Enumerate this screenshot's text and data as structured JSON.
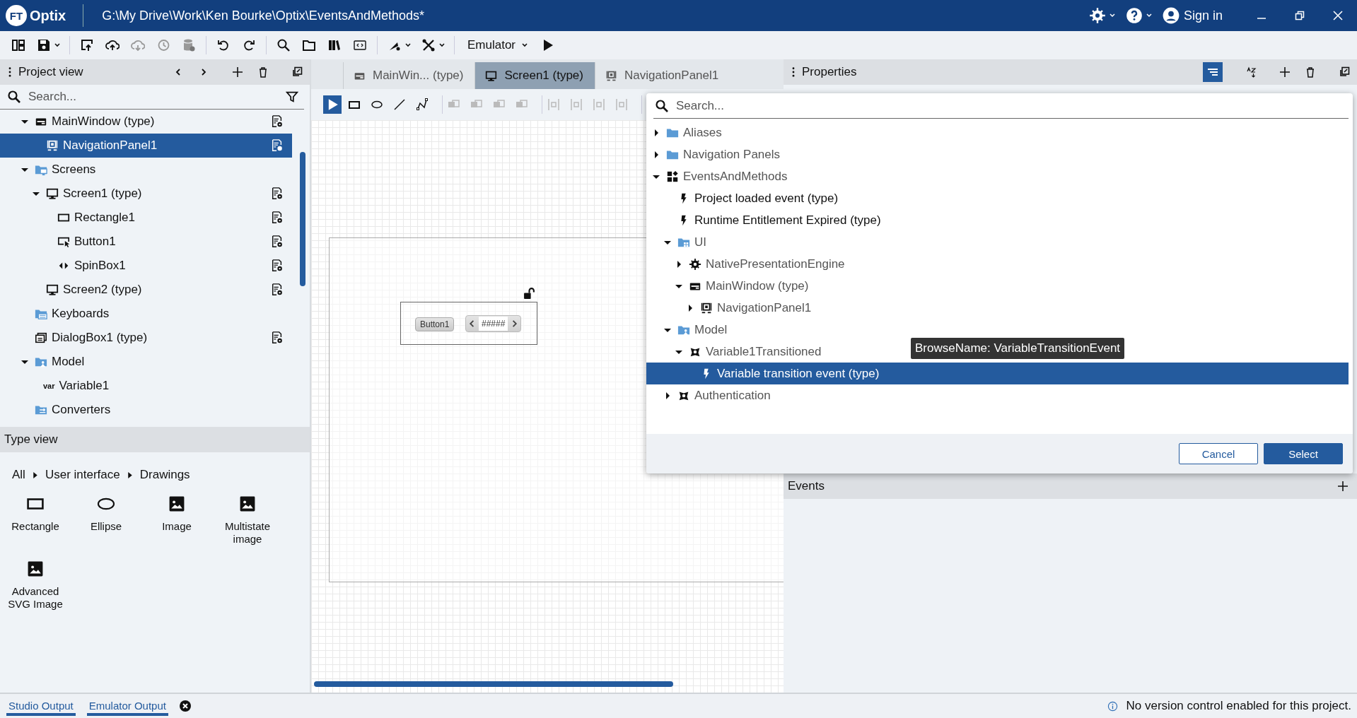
{
  "app": {
    "logo_badge": "FT",
    "logo": "Optix",
    "path": "G:\\My Drive\\Work\\Ken Bourke\\Optix\\EventsAndMethods*",
    "sign_in": "Sign in"
  },
  "toolbar": {
    "emulator": "Emulator"
  },
  "project_view": {
    "title": "Project view",
    "search": {
      "placeholder": "Search..."
    },
    "tree": [
      {
        "label": "MainWindow (type)",
        "kind": "window",
        "expanded": true,
        "selected": false,
        "settings_button": true,
        "children": [
          {
            "label": "NavigationPanel1",
            "kind": "panel",
            "selected": true,
            "settings_button": true
          }
        ]
      },
      {
        "label": "Screens",
        "kind": "screens-folder",
        "expanded": true,
        "selected": false,
        "settings_button": false,
        "children": [
          {
            "label": "Screen1 (type)",
            "kind": "screen",
            "expanded": true,
            "selected": false,
            "settings_button": true,
            "children": [
              {
                "label": "Rectangle1",
                "kind": "rectangle",
                "selected": false,
                "settings_button": true
              },
              {
                "label": "Button1",
                "kind": "button",
                "selected": false,
                "settings_button": true
              },
              {
                "label": "SpinBox1",
                "kind": "spinbox",
                "selected": false,
                "settings_button": true
              }
            ]
          },
          {
            "label": "Screen2 (type)",
            "kind": "screen",
            "selected": false,
            "settings_button": true
          }
        ]
      },
      {
        "label": "Keyboards",
        "kind": "keyboards-folder",
        "selected": false,
        "settings_button": false
      },
      {
        "label": "DialogBox1 (type)",
        "kind": "dialog",
        "selected": false,
        "settings_button": true
      },
      {
        "label": "Model",
        "kind": "model-folder",
        "expanded": true,
        "selected": false,
        "settings_button": false,
        "children": [
          {
            "label": "Variable1",
            "kind": "variable",
            "icon_text": "var",
            "selected": false,
            "settings_button": false
          }
        ]
      },
      {
        "label": "Converters",
        "kind": "converters-folder",
        "selected": false,
        "settings_button": false
      }
    ]
  },
  "type_view": {
    "title": "Type view",
    "breadcrumb": [
      "All",
      "User interface",
      "Drawings"
    ],
    "items": [
      {
        "label": "Rectangle",
        "kind": "rectangle"
      },
      {
        "label": "Ellipse",
        "kind": "ellipse"
      },
      {
        "label": "Image",
        "kind": "image"
      },
      {
        "label": "Multistate image",
        "kind": "image"
      },
      {
        "label": "Advanced SVG Image",
        "kind": "image"
      }
    ]
  },
  "editor": {
    "tabs": [
      {
        "label": "MainWin... (type)",
        "kind": "window",
        "selected": false
      },
      {
        "label": "Screen1 (type)",
        "kind": "screen",
        "selected": true
      },
      {
        "label": "NavigationPanel1",
        "kind": "panel",
        "selected": false
      }
    ],
    "canvas": {
      "button_label": "Button1",
      "spinbox_value": "#####"
    }
  },
  "properties": {
    "title": "Properties",
    "events_title": "Events"
  },
  "dialog": {
    "search": {
      "placeholder": "Search..."
    },
    "tree": [
      {
        "label": "Aliases",
        "kind": "folder",
        "expanded": false,
        "selected": false
      },
      {
        "label": "Navigation Panels",
        "kind": "folder",
        "expanded": false,
        "selected": false
      },
      {
        "label": "EventsAndMethods",
        "kind": "objects",
        "expanded": true,
        "selected": false,
        "children": [
          {
            "label": "Project loaded event (type)",
            "kind": "event",
            "selected": false
          },
          {
            "label": "Runtime Entitlement Expired (type)",
            "kind": "event",
            "selected": false
          },
          {
            "label": "UI",
            "kind": "ui-folder",
            "expanded": true,
            "selected": false,
            "children": [
              {
                "label": "NativePresentationEngine",
                "kind": "gear",
                "expanded": false,
                "selected": false
              },
              {
                "label": "MainWindow (type)",
                "kind": "window",
                "expanded": true,
                "selected": false,
                "children": [
                  {
                    "label": "NavigationPanel1",
                    "kind": "panel",
                    "expanded": false,
                    "selected": false
                  }
                ]
              }
            ]
          },
          {
            "label": "Model",
            "kind": "model-folder",
            "expanded": true,
            "selected": false,
            "children": [
              {
                "label": "Variable1Transitioned",
                "kind": "object-type",
                "expanded": true,
                "selected": false,
                "children": [
                  {
                    "label": "Variable transition event (type)",
                    "kind": "event",
                    "selected": true
                  }
                ]
              }
            ]
          },
          {
            "label": "Authentication",
            "kind": "object-type",
            "expanded": false,
            "selected": false
          }
        ]
      }
    ],
    "tooltip": "BrowseName: VariableTransitionEvent",
    "buttons": [
      {
        "label": "Cancel",
        "kind": "secondary"
      },
      {
        "label": "Select",
        "kind": "primary"
      }
    ]
  },
  "status_bar": {
    "tabs": [
      {
        "label": "Studio Output",
        "selected": true
      },
      {
        "label": "Emulator Output",
        "selected": true
      }
    ],
    "message": "No version control enabled for this project."
  }
}
